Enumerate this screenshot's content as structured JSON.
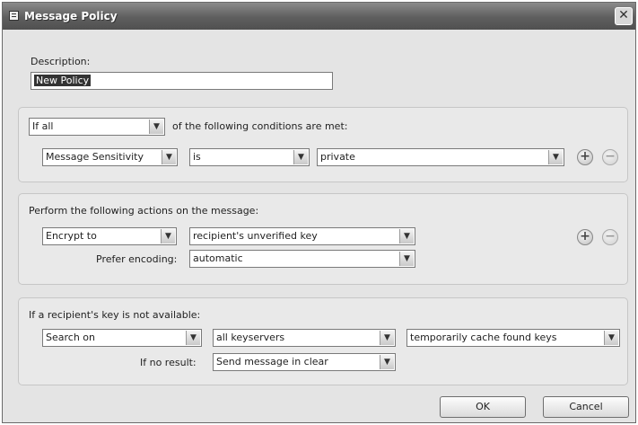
{
  "window": {
    "title": "Message Policy",
    "close_glyph": "✕"
  },
  "description": {
    "label": "Description:",
    "value": "New Policy"
  },
  "conditions": {
    "match_select": "If all",
    "suffix": "of the following conditions are met:",
    "row": {
      "field": "Message Sensitivity",
      "operator": "is",
      "value": "private"
    }
  },
  "actions": {
    "heading": "Perform the following actions on the message:",
    "action_select": "Encrypt to",
    "key_select": "recipient's unverified key",
    "encoding_label": "Prefer encoding:",
    "encoding_select": "automatic"
  },
  "missing_key": {
    "heading": "If a recipient's key is not available:",
    "action_select": "Search on",
    "server_select": "all keyservers",
    "cache_select": "temporarily cache found keys",
    "no_result_label": "If no result:",
    "no_result_select": "Send message in clear"
  },
  "icons": {
    "add": "+",
    "remove": "−",
    "dropdown": "▼"
  },
  "buttons": {
    "ok": "OK",
    "cancel": "Cancel"
  }
}
